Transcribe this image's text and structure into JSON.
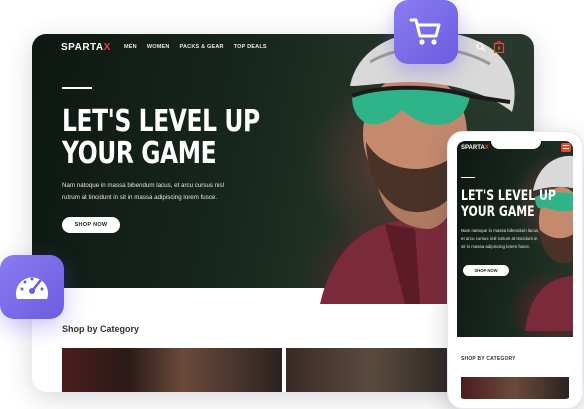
{
  "desktop": {
    "nav": {
      "logo_main": "SPARTA",
      "logo_accent": "X",
      "links": [
        "MEN",
        "WOMEN",
        "PACKS & GEAR",
        "TOP DEALS"
      ]
    },
    "hero": {
      "title_line1": "LET'S LEVEL UP",
      "title_line2": "YOUR GAME",
      "subtitle_line1": "Nam natoque in massa bibendum lacus, et arcu cursus nisl",
      "subtitle_line2": "rutrum at tincidunt in sit in massa adipiscing lorem fusce.",
      "button_label": "SHOP NOW"
    },
    "category_heading": "Shop by Category"
  },
  "mobile": {
    "logo": "SPARTA",
    "title_line1": "LET'S LEVEL UP",
    "title_line2": "YOUR GAME",
    "subtitle_lines": [
      "Nam natoque in massa bibendum lacus,",
      "et arcu cursus nisl rutrum at tincidunt in",
      "sit in massa adipiscing lorem fusce."
    ],
    "button_label": "SHOP NOW",
    "category_heading": "SHOP BY CATEGORY"
  },
  "colors": {
    "accent": "#e8452c",
    "badge": "#7b6cea",
    "hero_dark": "#17261c"
  },
  "icons": {
    "floating_top": "shopping-cart-icon",
    "floating_left": "speedometer-icon",
    "nav_search": "search-icon",
    "nav_cart": "shopping-bag-icon",
    "mobile_menu": "hamburger-menu-icon"
  }
}
